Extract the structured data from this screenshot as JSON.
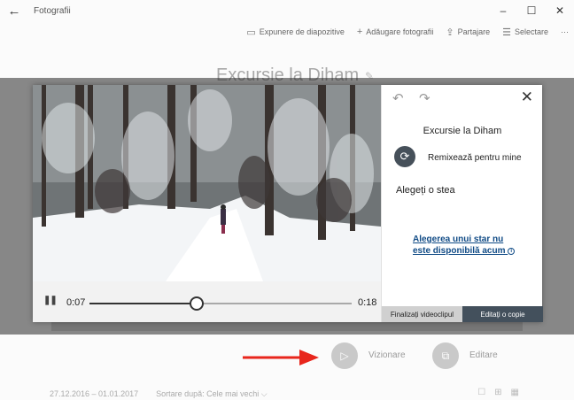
{
  "app": {
    "title": "Fotografii",
    "back_icon": "arrow-left-icon",
    "window_controls": {
      "minimize": "–",
      "maximize": "☐",
      "close": "✕"
    }
  },
  "toolbar": {
    "slideshow": "Expunere de diapozitive",
    "add_photos": "Adăugare fotografii",
    "share": "Partajare",
    "select": "Selectare",
    "more": "···"
  },
  "album": {
    "title": "Excursie la Diham"
  },
  "player": {
    "current_time": "0:07",
    "end_time": "0:18",
    "progress": 0.41,
    "pause_icon": "pause-icon"
  },
  "panel": {
    "title": "Excursie la Diham",
    "remix_label": "Remixează pentru mine",
    "star_label": "Alegeți o stea",
    "star_link": "Alegerea unui star nu este disponibilă acum",
    "info_glyph": "i",
    "finalize_button": "Finalizați videoclipul",
    "edit_copy_button": "Editați o copie"
  },
  "actions": {
    "play_label": "Vizionare",
    "edit_label": "Editare"
  },
  "footer": {
    "date_range": "27.12.2016 – 01.01.2017",
    "sort_label": "Sortare după:",
    "sort_value": "Cele mai vechi"
  },
  "colors": {
    "accent_dark": "#43505c",
    "link": "#0f4a85",
    "arrow": "#e8261c"
  }
}
